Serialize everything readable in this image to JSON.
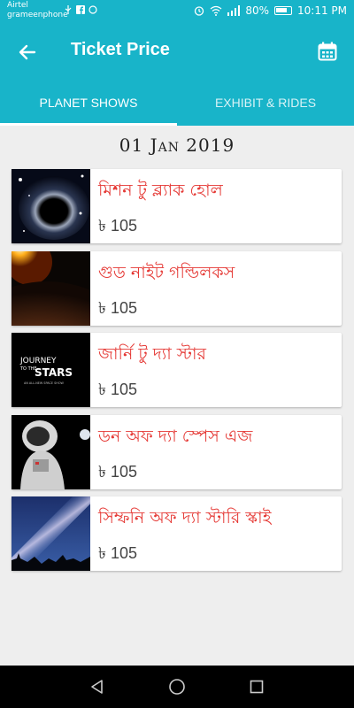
{
  "status_bar": {
    "carrier_1": "Airtel",
    "carrier_2": "grameenphone",
    "battery": "80%",
    "time": "10:11 PM"
  },
  "app_bar": {
    "title": "Ticket Price",
    "back_icon": "arrow-back-icon",
    "calendar_icon": "calendar-icon"
  },
  "tabs": [
    {
      "label": "PLANET SHOWS",
      "active": true
    },
    {
      "label": "EXHIBIT & RIDES",
      "active": false
    }
  ],
  "date": "01 Jan 2019",
  "shows": [
    {
      "title": "মিশন টু ব্ল্যাক হোল",
      "price": "৳ 105"
    },
    {
      "title": "গুড নাইট গল্ডিলকস",
      "price": "৳ 105"
    },
    {
      "title": "জার্নি টু দ্যা স্টার",
      "price": "৳ 105",
      "thumb_text_1": "JOURNEY",
      "thumb_text_2": "TO THE",
      "thumb_text_3": "STARS",
      "thumb_text_4": "AN ALL-NEW SPACE SHOW"
    },
    {
      "title": "ডন অফ দ্যা স্পেস এজ",
      "price": "৳ 105"
    },
    {
      "title": "সিম্ফনি অফ দ্যা স্টারি স্কাই",
      "price": "৳ 105"
    }
  ],
  "colors": {
    "primary": "#18b4c9",
    "title_red": "#e53935"
  }
}
